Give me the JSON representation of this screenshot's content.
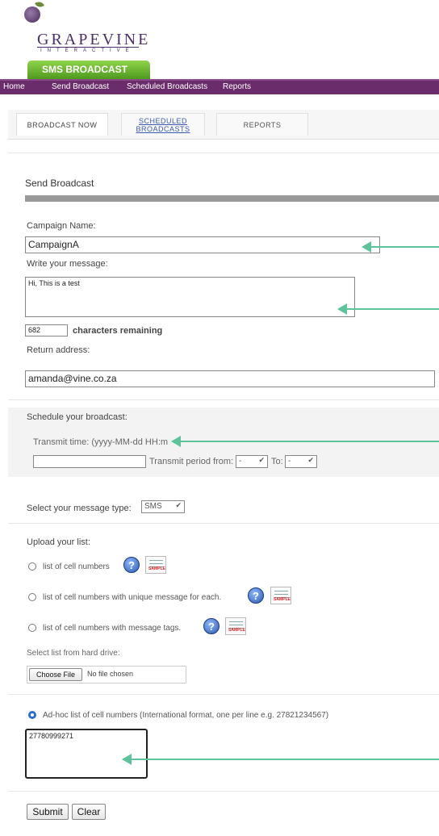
{
  "brand": {
    "name": "GRAPEVINE",
    "tagline": "INTERACTIVE",
    "product_tab": "SMS BROADCAST"
  },
  "nav": {
    "items": [
      "Home",
      "Send Broadcast",
      "Scheduled Broadcasts",
      "Reports"
    ]
  },
  "tabs": {
    "broadcast_now": "BROADCAST NOW",
    "scheduled_line1": "SCHEDULED",
    "scheduled_line2": "BROADCASTS",
    "reports": "REPORTS"
  },
  "form": {
    "section_title": "Send Broadcast",
    "campaign_label": "Campaign Name:",
    "campaign_value": "CampaignA",
    "message_label": "Write your message:",
    "message_value": "Hi, This is a test",
    "chars_remaining_value": "682",
    "chars_remaining_label": "characters remaining",
    "return_label": "Return address:",
    "return_value": "amanda@vine.co.za"
  },
  "schedule": {
    "title": "Schedule your broadcast:",
    "transmit_time_label": "Transmit time: (yyyy-MM-dd HH:m",
    "transmit_period_label": "Transmit period from:",
    "from_value": "-",
    "to_label": "To:",
    "to_value": "-"
  },
  "message_type": {
    "label": "Select your message type:",
    "value": "SMS"
  },
  "upload": {
    "title": "Upload your list:",
    "options": [
      "list of cell numbers",
      "list of cell numbers with unique message for each.",
      "list of cell numbers with message tags."
    ],
    "help_glyph": "?",
    "sample_text": "SAMPLE",
    "file_label": "Select list from hard drive:",
    "choose_file": "Choose File",
    "no_file": "No file chosen"
  },
  "adhoc": {
    "label": "Ad-hoc list of cell numbers (International format, one per line e.g. 27821234567)",
    "value": "27780999271"
  },
  "actions": {
    "submit": "Submit",
    "clear": "Clear"
  },
  "colors": {
    "nav_purple": "#6a2c6a",
    "tab_green": "#5fb22a",
    "arrow_green": "#5cc39a",
    "radio_blue": "#2a6dd5"
  }
}
